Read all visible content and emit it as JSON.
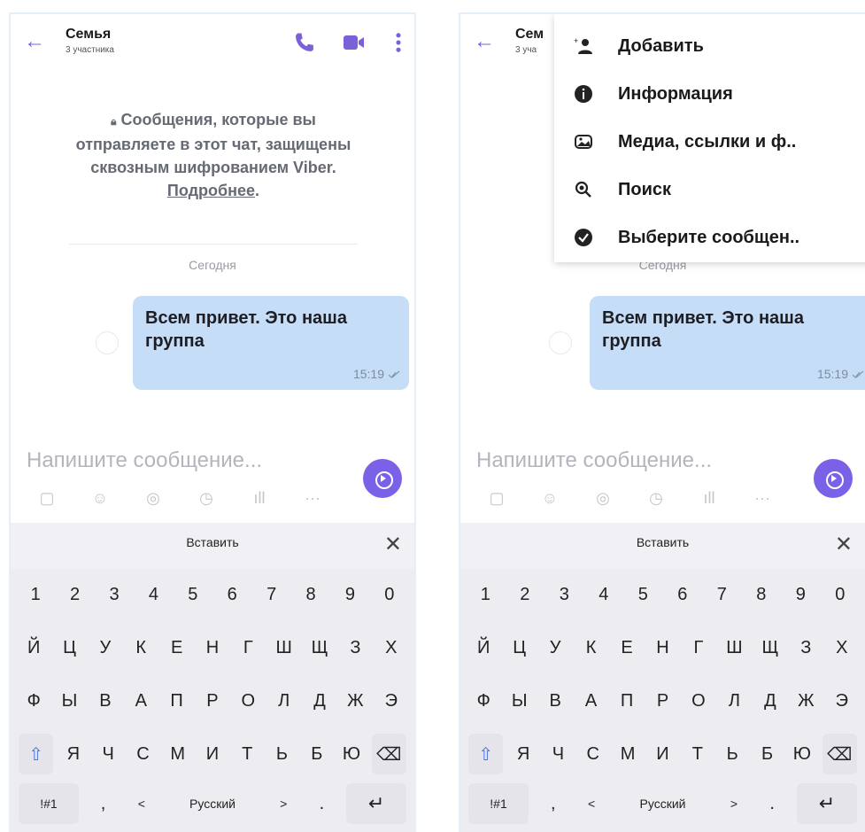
{
  "chat": {
    "title": "Семья",
    "title_cut": "Сем",
    "subtitle": "3 участника",
    "subtitle_cut": "3 уча",
    "encryption_notice": "Сообщения, которые вы отправляете в этот чат, защищены сквозным шифрованием Viber.",
    "encryption_link": "Подробнее",
    "encryption_period": ".",
    "day_separator": "Сегодня",
    "message": {
      "text": "Всем привет. Это наша группа",
      "time": "15:19"
    }
  },
  "composer": {
    "placeholder": "Напишите сообщение..."
  },
  "keyboard": {
    "paste_label": "Вставить",
    "close_label": "✕",
    "number_row": [
      "1",
      "2",
      "3",
      "4",
      "5",
      "6",
      "7",
      "8",
      "9",
      "0"
    ],
    "row1": [
      "Й",
      "Ц",
      "У",
      "К",
      "Е",
      "Н",
      "Г",
      "Ш",
      "Щ",
      "З",
      "Х"
    ],
    "row2": [
      "Ф",
      "Ы",
      "В",
      "А",
      "П",
      "Р",
      "О",
      "Л",
      "Д",
      "Ж",
      "Э"
    ],
    "row3": [
      "Я",
      "Ч",
      "С",
      "М",
      "И",
      "Т",
      "Ь",
      "Б",
      "Ю"
    ],
    "symbols_label": "!#1",
    "comma_label": ",",
    "lang_left": "<",
    "language_label": "Русский",
    "lang_right": ">",
    "period_label": ".",
    "enter_label": "↵",
    "shift_label": "⇧",
    "backspace_label": "⌫"
  },
  "menu": {
    "items": [
      {
        "label": "Добавить",
        "icon": "add-participant-icon"
      },
      {
        "label": "Информация",
        "icon": "info-icon"
      },
      {
        "label": "Медиа, ссылки и ф..",
        "icon": "media-icon"
      },
      {
        "label": "Поиск",
        "icon": "search-icon"
      },
      {
        "label": "Выберите сообщен..",
        "icon": "select-check-icon"
      }
    ]
  },
  "colors": {
    "accent": "#7b61d8",
    "bubble": "#c6ddf7",
    "send_button": "#7b61e8"
  }
}
